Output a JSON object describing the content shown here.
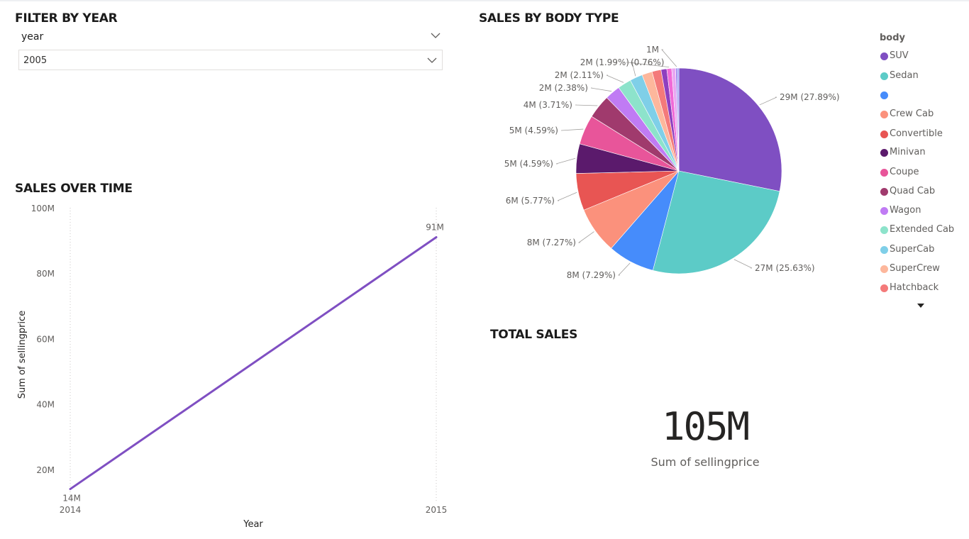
{
  "filter": {
    "title": "FILTER BY YEAR",
    "field": "year",
    "selected": "2005"
  },
  "sales_over_time": {
    "title": "SALES OVER TIME",
    "ylabel": "Sum of sellingprice",
    "xlabel": "Year",
    "y_ticks": [
      "100M",
      "80M",
      "60M",
      "40M",
      "20M"
    ],
    "x_ticks": [
      "2014",
      "2015"
    ],
    "line_color": "#7f4fc2"
  },
  "sales_by_body": {
    "title": "SALES BY BODY TYPE",
    "legend_title": "body"
  },
  "total_sales": {
    "title": "TOTAL SALES",
    "value": "105M",
    "label": "Sum of sellingprice"
  },
  "chart_data": [
    {
      "type": "line",
      "title": "SALES OVER TIME",
      "xlabel": "Year",
      "ylabel": "Sum of sellingprice",
      "x": [
        "2014",
        "2015"
      ],
      "ylim": [
        10,
        100
      ],
      "y_unit": "M",
      "series": [
        {
          "values": [
            14,
            91
          ],
          "labels": [
            "14M",
            "91M"
          ],
          "color": "#7f4fc2"
        }
      ]
    },
    {
      "type": "pie",
      "title": "SALES BY BODY TYPE",
      "legend_title": "body",
      "legend_placement": "right",
      "slices": [
        {
          "name": "SUV",
          "percent": 27.89,
          "label": "29M (27.89%)",
          "color": "#7f4fc2"
        },
        {
          "name": "Sedan",
          "percent": 25.63,
          "label": "27M (25.63%)",
          "color": "#5ccbc7"
        },
        {
          "name": "",
          "percent": 7.29,
          "label": "8M (7.29%)",
          "color": "#468cfb"
        },
        {
          "name": "Crew Cab",
          "percent": 7.27,
          "label": "8M (7.27%)",
          "color": "#fb917c"
        },
        {
          "name": "Convertible",
          "percent": 5.77,
          "label": "6M (5.77%)",
          "color": "#e85553"
        },
        {
          "name": "Minivan",
          "percent": 4.59,
          "label": "5M (4.59%)",
          "color": "#5b1a6c"
        },
        {
          "name": "Coupe",
          "percent": 4.59,
          "label": "5M (4.59%)",
          "color": "#e8559a"
        },
        {
          "name": "Quad Cab",
          "percent": 3.71,
          "label": "4M (3.71%)",
          "color": "#a03a6d"
        },
        {
          "name": "Wagon",
          "percent": 2.38,
          "label": "2M (2.38%)",
          "color": "#c07bf4"
        },
        {
          "name": "Extended Cab",
          "percent": 2.11,
          "label": "2M (2.11%)",
          "color": "#8de3cb"
        },
        {
          "name": "SuperCab",
          "percent": 1.99,
          "label": "2M (1.99%)",
          "color": "#7fcfe8"
        },
        {
          "name": "SuperCrew",
          "percent": 1.6,
          "label": "",
          "color": "#fdb79c"
        },
        {
          "name": "Hatchback",
          "percent": 1.4,
          "label": "",
          "color": "#f47a7a"
        },
        {
          "name": "",
          "percent": 0.9,
          "label": "",
          "color": "#8f3fbf"
        },
        {
          "name": "",
          "percent": 0.76,
          "label": "(0.76%)",
          "color": "#f06ad7"
        },
        {
          "name": "",
          "percent": 0.6,
          "label": "",
          "color": "#e9a6f1"
        },
        {
          "name": "",
          "percent": 0.3,
          "label": "1M",
          "color": "#a58cf0"
        },
        {
          "name": "",
          "percent": 0.2,
          "label": "",
          "color": "#7e8ff2"
        }
      ]
    }
  ]
}
